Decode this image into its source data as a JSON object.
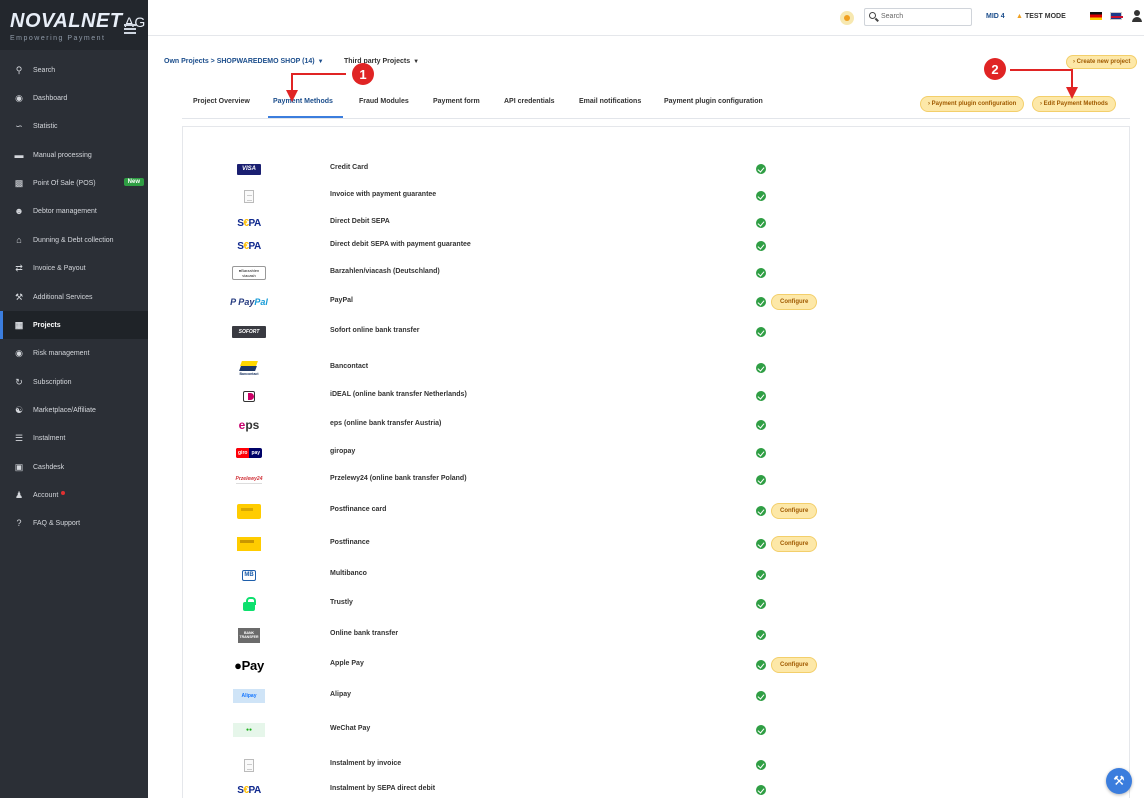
{
  "logo": {
    "brand": "NOVALNET",
    "suffix": "AG",
    "tagline": "Empowering Payment"
  },
  "sidebar": {
    "items": [
      {
        "label": "Search",
        "icon": "search-icon"
      },
      {
        "label": "Dashboard",
        "icon": "dashboard-icon"
      },
      {
        "label": "Statistic",
        "icon": "chart-icon"
      },
      {
        "label": "Manual processing",
        "icon": "card-icon"
      },
      {
        "label": "Point Of Sale (POS)",
        "icon": "pos-icon",
        "badge": "New"
      },
      {
        "label": "Debtor management",
        "icon": "users-icon"
      },
      {
        "label": "Dunning & Debt collection",
        "icon": "bank-icon"
      },
      {
        "label": "Invoice & Payout",
        "icon": "exchange-icon"
      },
      {
        "label": "Additional Services",
        "icon": "wrench-icon"
      },
      {
        "label": "Projects",
        "icon": "sitemap-icon",
        "active": true
      },
      {
        "label": "Risk management",
        "icon": "shield-icon"
      },
      {
        "label": "Subscription",
        "icon": "refresh-icon"
      },
      {
        "label": "Marketplace/Affiliate",
        "icon": "group-icon"
      },
      {
        "label": "Instalment",
        "icon": "coins-icon"
      },
      {
        "label": "Cashdesk",
        "icon": "cashdesk-icon"
      },
      {
        "label": "Account",
        "icon": "user-icon",
        "alert": true
      },
      {
        "label": "FAQ & Support",
        "icon": "question-icon"
      }
    ]
  },
  "topbar": {
    "search_placeholder": "Search",
    "mid": "MID 4",
    "test_mode": "TEST MODE"
  },
  "breadcrumb": {
    "own_projects": "Own Projects > SHOPWAREDEMO SHOP (14)",
    "third_party": "Third party Projects",
    "create_new": "Create new project"
  },
  "tabs": [
    {
      "label": "Project Overview"
    },
    {
      "label": "Payment Methods",
      "active": true
    },
    {
      "label": "Fraud Modules"
    },
    {
      "label": "Payment form"
    },
    {
      "label": "API credentials"
    },
    {
      "label": "Email notifications"
    },
    {
      "label": "Payment plugin configuration"
    }
  ],
  "actions": {
    "plugin_config": "Payment plugin configuration",
    "edit_methods": "Edit Payment Methods"
  },
  "payment_methods": [
    {
      "name": "Credit Card",
      "logo": "visa-logo",
      "logo_text": "VISA"
    },
    {
      "name": "Invoice with payment guarantee",
      "logo": "invoice-logo"
    },
    {
      "name": "Direct Debit SEPA",
      "logo": "sepa-logo"
    },
    {
      "name": "Direct debit SEPA with payment guarantee",
      "logo": "sepa-logo"
    },
    {
      "name": "Barzahlen/viacash (Deutschland)",
      "logo": "barzahlen-logo"
    },
    {
      "name": "PayPal",
      "logo": "paypal-logo",
      "configure": "Configure"
    },
    {
      "name": "Sofort online bank transfer",
      "logo": "sofort-logo",
      "logo_text": "SOFORT"
    },
    {
      "name": "Bancontact",
      "logo": "bancontact-logo",
      "logo_text": "Bancontact"
    },
    {
      "name": "iDEAL (online bank transfer Netherlands)",
      "logo": "ideal-logo"
    },
    {
      "name": "eps (online bank transfer Austria)",
      "logo": "eps-logo"
    },
    {
      "name": "giropay",
      "logo": "giropay-logo"
    },
    {
      "name": "Przelewy24 (online bank transfer Poland)",
      "logo": "przelewy24-logo",
      "logo_text": "Przelewy24"
    },
    {
      "name": "Postfinance card",
      "logo": "postfinance-card-logo",
      "configure": "Configure"
    },
    {
      "name": "Postfinance",
      "logo": "postfinance-logo",
      "configure": "Configure"
    },
    {
      "name": "Multibanco",
      "logo": "multibanco-logo",
      "logo_text": "MB"
    },
    {
      "name": "Trustly",
      "logo": "trustly-logo"
    },
    {
      "name": "Online bank transfer",
      "logo": "bank-transfer-logo",
      "logo_text": "BANK TRANSFER"
    },
    {
      "name": "Apple Pay",
      "logo": "applepay-logo",
      "logo_text": "Pay",
      "configure": "Configure"
    },
    {
      "name": "Alipay",
      "logo": "alipay-logo",
      "logo_text": "Alipay"
    },
    {
      "name": "WeChat Pay",
      "logo": "wechat-logo"
    },
    {
      "name": "Instalment by invoice",
      "logo": "invoice-logo"
    },
    {
      "name": "Instalment by SEPA direct debit",
      "logo": "sepa-logo"
    }
  ],
  "annotations": {
    "marker1": "1",
    "marker2": "2",
    "arrow_color": "#e02424"
  },
  "colors": {
    "sidebar_bg": "#2b2f36",
    "accent": "#3b7ddd",
    "status_ok": "#2f9e44",
    "pill_bg": "#fde8a8"
  }
}
